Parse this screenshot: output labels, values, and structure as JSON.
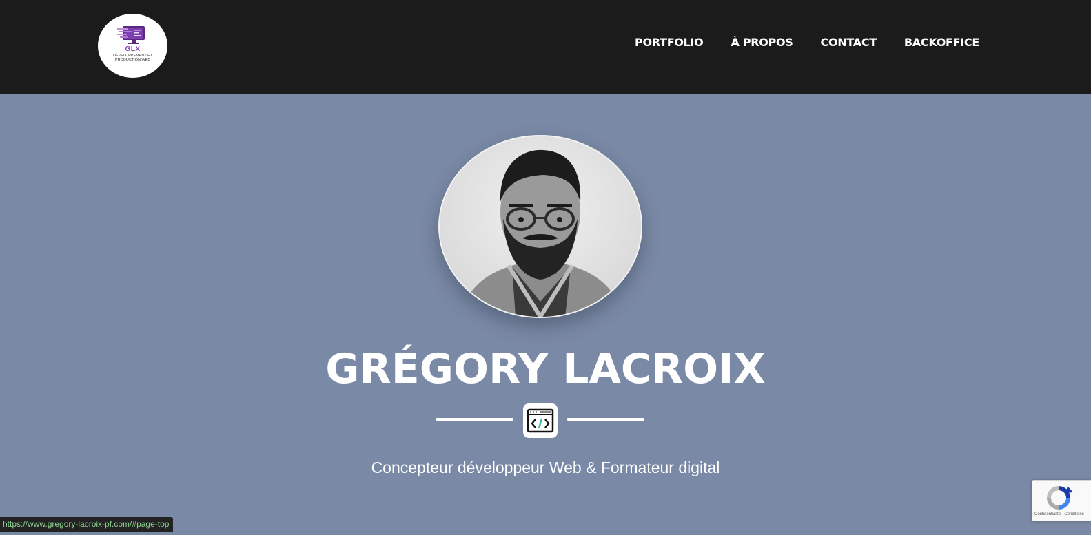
{
  "logo": {
    "mark": "GLX",
    "subtitle": "Développement et production web",
    "icon": "monitor-code-icon"
  },
  "nav": {
    "items": [
      {
        "label": "Portfolio"
      },
      {
        "label": "À propos"
      },
      {
        "label": "Contact"
      },
      {
        "label": "Backoffice"
      }
    ]
  },
  "hero": {
    "name": "GRÉGORY LACROIX",
    "divider_icon": "browser-code-icon",
    "tagline": "Concepteur développeur Web & Formateur digital",
    "avatar_icon": "profile-photo"
  },
  "recaptcha": {
    "label": "Confidentialité - Conditions",
    "icon": "recaptcha-icon"
  },
  "status_bar": {
    "url": "https://www.gregory-lacroix-pf.com/#page-top"
  },
  "colors": {
    "header_bg": "#1b1b1b",
    "hero_bg": "#7a89a5",
    "text": "#ffffff",
    "logo_accent": "#8a3fb3",
    "code_accent": "#3cb9a8"
  }
}
